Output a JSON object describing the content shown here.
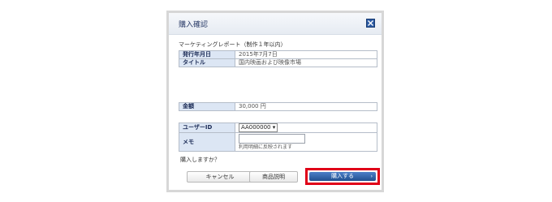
{
  "dialog": {
    "title": "購入確認",
    "product_heading": "マーケティングレポート（制作１年以内）",
    "info_rows": [
      {
        "label": "発行年月日",
        "value": "2015年7月7日"
      },
      {
        "label": "タイトル",
        "value": "国内映画および映像市場"
      }
    ],
    "amount": {
      "label": "金額",
      "value": "30,000 円"
    },
    "user_id": {
      "label": "ユーザーID",
      "selected": "AA000000"
    },
    "memo": {
      "label": "メモ",
      "value": "",
      "note": "利用明細に反映されます"
    },
    "confirm_text": "購入しますか？",
    "buttons": {
      "cancel": "キャンセル",
      "product_info": "商品説明",
      "buy": "購入する",
      "buy_arrow": "›"
    }
  },
  "colors": {
    "highlight": "#e00018",
    "buy_button": "#2f61a8",
    "label_bg": "#dce6f4"
  }
}
